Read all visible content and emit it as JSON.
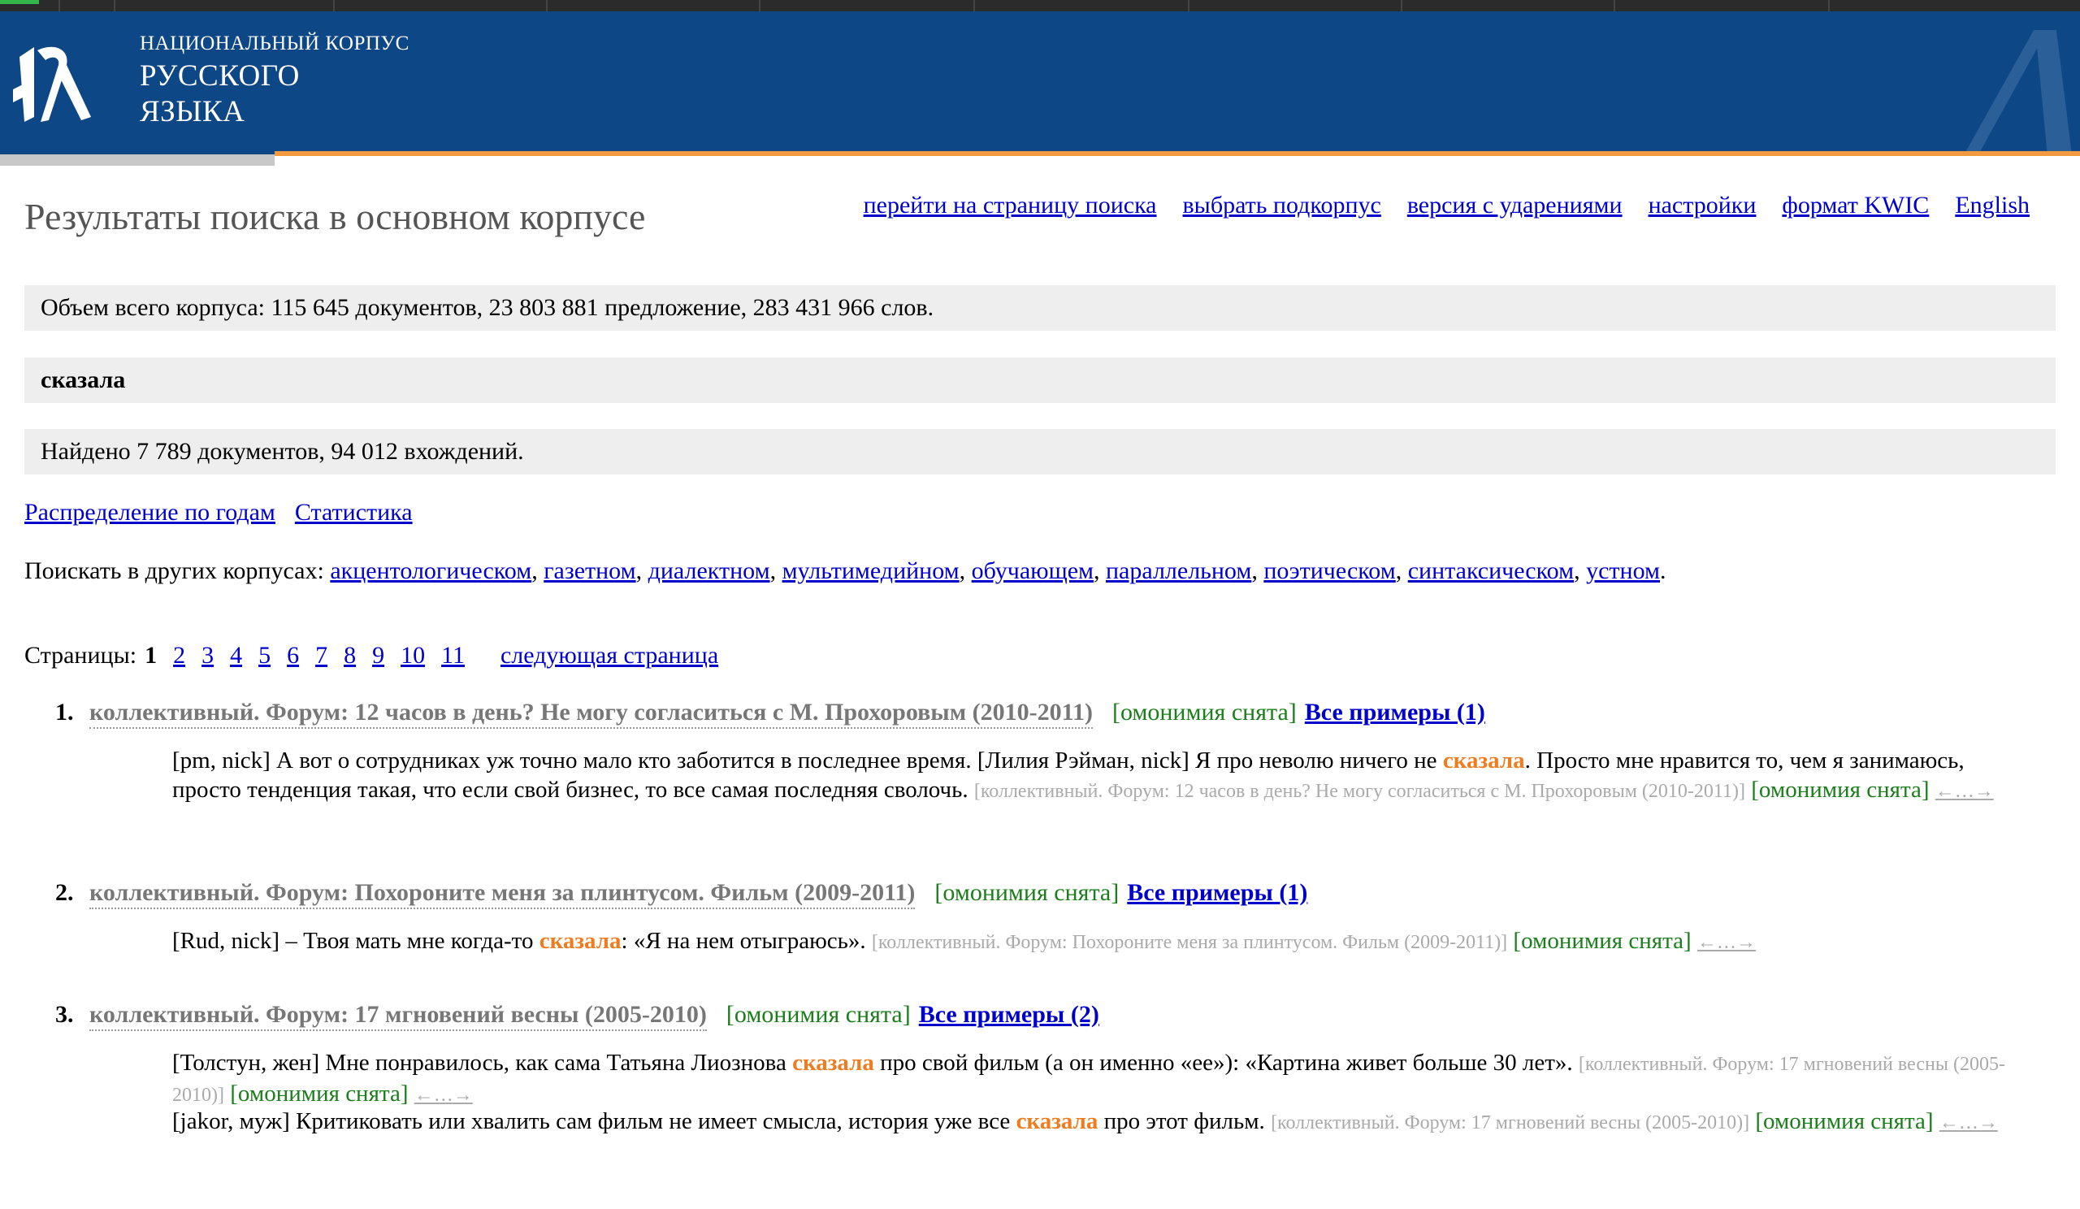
{
  "header": {
    "logo_line1": "НАЦИОНАЛЬНЫЙ КОРПУС",
    "logo_line2": "РУССКОГО",
    "logo_line3": "ЯЗЫКА"
  },
  "page_title": "Результаты поиска в основном корпусе",
  "top_links": [
    "перейти на страницу поиска",
    "выбрать подкорпус",
    "версия с ударениями",
    "настройки",
    "формат KWIC",
    "English"
  ],
  "corpus_size": "Объем всего корпуса: 115 645 документов, 23 803 881 предложение, 283 431 966 слов.",
  "query": "сказала",
  "found": "Найдено 7 789 документов, 94 012 вхождений.",
  "distribution_links": [
    "Распределение по годам",
    "Статистика"
  ],
  "other_corpora": {
    "label": "Поискать в других корпусах:",
    "items": [
      "акцентологическом",
      "газетном",
      "диалектном",
      "мультимедийном",
      "обучающем",
      "параллельном",
      "поэтическом",
      "синтаксическом",
      "устном"
    ]
  },
  "pagination": {
    "label": "Страницы:",
    "current": "1",
    "pages": [
      "2",
      "3",
      "4",
      "5",
      "6",
      "7",
      "8",
      "9",
      "10",
      "11"
    ],
    "next": "следующая страница"
  },
  "homonymy_label": "[омонимия снята]",
  "context_link": "←…→",
  "results": [
    {
      "num": "1.",
      "source": "коллективный. Форум: 12 часов в день? Не могу согласиться с М. Прохоровым (2010-2011)",
      "all_examples": "Все примеры (1)",
      "examples": [
        {
          "before": "[pm, nick] А вот о сотрудниках уж точно мало кто заботится в последнее время. [Лилия Рэйман, nick] Я про неволю ничего не ",
          "hit": "сказала",
          "after": ". Просто мне нравится то, чем я занимаюсь, просто тенденция такая, что если свой бизнес, то все самая последняя сволочь. ",
          "ref": "[коллективный. Форум: 12 часов в день? Не могу согласиться с М. Прохоровым (2010-2011)]"
        }
      ]
    },
    {
      "num": "2.",
      "source": "коллективный. Форум: Похороните меня за плинтусом. Фильм (2009-2011)",
      "all_examples": "Все примеры (1)",
      "examples": [
        {
          "before": "[Rud, nick] – Твоя мать мне когда-то ",
          "hit": "сказала",
          "after": ": «Я на нем отыграюсь». ",
          "ref": "[коллективный. Форум: Похороните меня за плинтусом. Фильм (2009-2011)]"
        }
      ]
    },
    {
      "num": "3.",
      "source": "коллективный. Форум: 17 мгновений весны (2005-2010)",
      "all_examples": "Все примеры (2)",
      "examples": [
        {
          "before": "[Толстун, жен] Мне понравилось, как сама Татьяна Лиознова ",
          "hit": "сказала",
          "after": " про свой фильм (а он именно «ее»): «Картина живет больше 30 лет». ",
          "ref": "[коллективный. Форум: 17 мгновений весны (2005-2010)]"
        },
        {
          "before": "[jakor, муж] Критиковать или хвалить сам фильм не имеет смысла, история уже все ",
          "hit": "сказала",
          "after": " про этот фильм. ",
          "ref": "[коллективный. Форум: 17 мгновений весны (2005-2010)]"
        }
      ]
    }
  ]
}
